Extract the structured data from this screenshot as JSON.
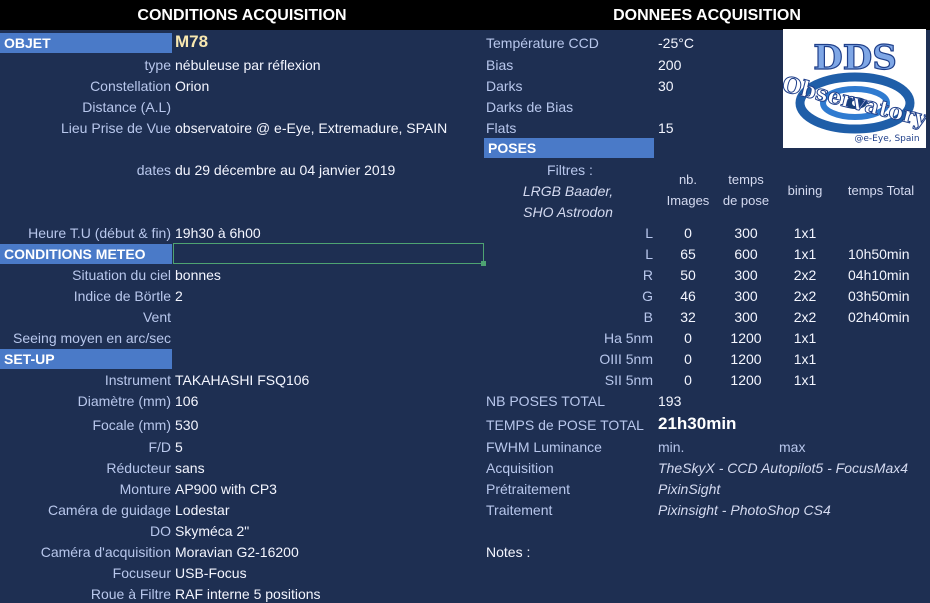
{
  "headers": {
    "left": "CONDITIONS ACQUISITION",
    "right": "DONNEES ACQUISITION"
  },
  "sections": {
    "objet": "OBJET",
    "meteo": "CONDITIONS METEO",
    "setup": "SET-UP",
    "poses": "POSES"
  },
  "object_name": "M78",
  "left_fields": [
    {
      "label": "type",
      "value": "nébuleuse par réflexion"
    },
    {
      "label": "Constellation",
      "value": "Orion"
    },
    {
      "label": "Distance (A.L)",
      "value": ""
    },
    {
      "label": "Lieu Prise de Vue",
      "value": "observatoire @ e-Eye, Extremadure, SPAIN"
    },
    {
      "label": "dates",
      "value": "du 29 décembre au 04 janvier 2019"
    },
    {
      "label": "Heure T.U (début & fin)",
      "value": "19h30 à 6h00"
    }
  ],
  "meteo_fields": [
    {
      "label": "Situation du ciel",
      "value": "bonnes"
    },
    {
      "label": "Indice de Börtle",
      "value": "2"
    },
    {
      "label": "Vent",
      "value": ""
    },
    {
      "label": "Seeing moyen en arc/sec",
      "value": ""
    }
  ],
  "setup_fields": [
    {
      "label": "Instrument",
      "value": "TAKAHASHI FSQ106"
    },
    {
      "label": "Diamètre (mm)",
      "value": "106"
    },
    {
      "label": "Focale (mm)",
      "value": "530"
    },
    {
      "label": "F/D",
      "value": "5"
    },
    {
      "label": "Réducteur",
      "value": "sans"
    },
    {
      "label": "Monture",
      "value": "AP900 with CP3"
    },
    {
      "label": "Caméra de guidage",
      "value": "Lodestar"
    },
    {
      "label": "DO",
      "value": "Skyméca 2\""
    },
    {
      "label": "Caméra d'acquisition",
      "value": "Moravian G2-16200"
    },
    {
      "label": "Focuseur",
      "value": "USB-Focus"
    },
    {
      "label": "Roue à Filtre",
      "value": "RAF interne 5 positions"
    }
  ],
  "right_fields": [
    {
      "label": "Température CCD",
      "value": "-25°C"
    },
    {
      "label": "Bias",
      "value": "200"
    },
    {
      "label": "Darks",
      "value": "30"
    },
    {
      "label": "Darks de Bias",
      "value": ""
    },
    {
      "label": "Flats",
      "value": "15"
    }
  ],
  "poses": {
    "filters_title": "Filtres :",
    "filters_line1": "LRGB Baader,",
    "filters_line2": "SHO Astrodon",
    "col_images": [
      "nb.",
      "Images"
    ],
    "col_pose": [
      "temps",
      "de pose"
    ],
    "col_bining": "bining",
    "col_total": "temps Total",
    "rows": [
      {
        "filter": "L",
        "n": "0",
        "t": "300",
        "bin": "1x1",
        "total": ""
      },
      {
        "filter": "L",
        "n": "65",
        "t": "600",
        "bin": "1x1",
        "total": "10h50min"
      },
      {
        "filter": "R",
        "n": "50",
        "t": "300",
        "bin": "2x2",
        "total": "04h10min"
      },
      {
        "filter": "G",
        "n": "46",
        "t": "300",
        "bin": "2x2",
        "total": "03h50min"
      },
      {
        "filter": "B",
        "n": "32",
        "t": "300",
        "bin": "2x2",
        "total": "02h40min"
      },
      {
        "filter": "Ha 5nm",
        "n": "0",
        "t": "1200",
        "bin": "1x1",
        "total": ""
      },
      {
        "filter": "OIII 5nm",
        "n": "0",
        "t": "1200",
        "bin": "1x1",
        "total": ""
      },
      {
        "filter": "SII 5nm",
        "n": "0",
        "t": "1200",
        "bin": "1x1",
        "total": ""
      }
    ]
  },
  "totals": {
    "nb_label": "NB POSES TOTAL",
    "nb_value": "193",
    "time_label": "TEMPS de POSE TOTAL",
    "time_value": "21h30min",
    "fwhm_label": "FWHM Luminance",
    "fwhm_min": "min.",
    "fwhm_max": "max"
  },
  "software": [
    {
      "label": "Acquisition",
      "value": "TheSkyX - CCD Autopilot5 - FocusMax4"
    },
    {
      "label": "Prétraitement",
      "value": "PixinSight"
    },
    {
      "label": "Traitement",
      "value": "Pixinsight - PhotoShop CS4"
    }
  ],
  "notes_label": "Notes :",
  "logo": {
    "title": "DDS",
    "subtitle": "Observatory",
    "tagline": "@e-Eye, Spain"
  },
  "colors": {
    "background": "#1e2f52",
    "band": "#4a7ac8",
    "header": "#000000",
    "accent_text": "#f7e7b0"
  }
}
